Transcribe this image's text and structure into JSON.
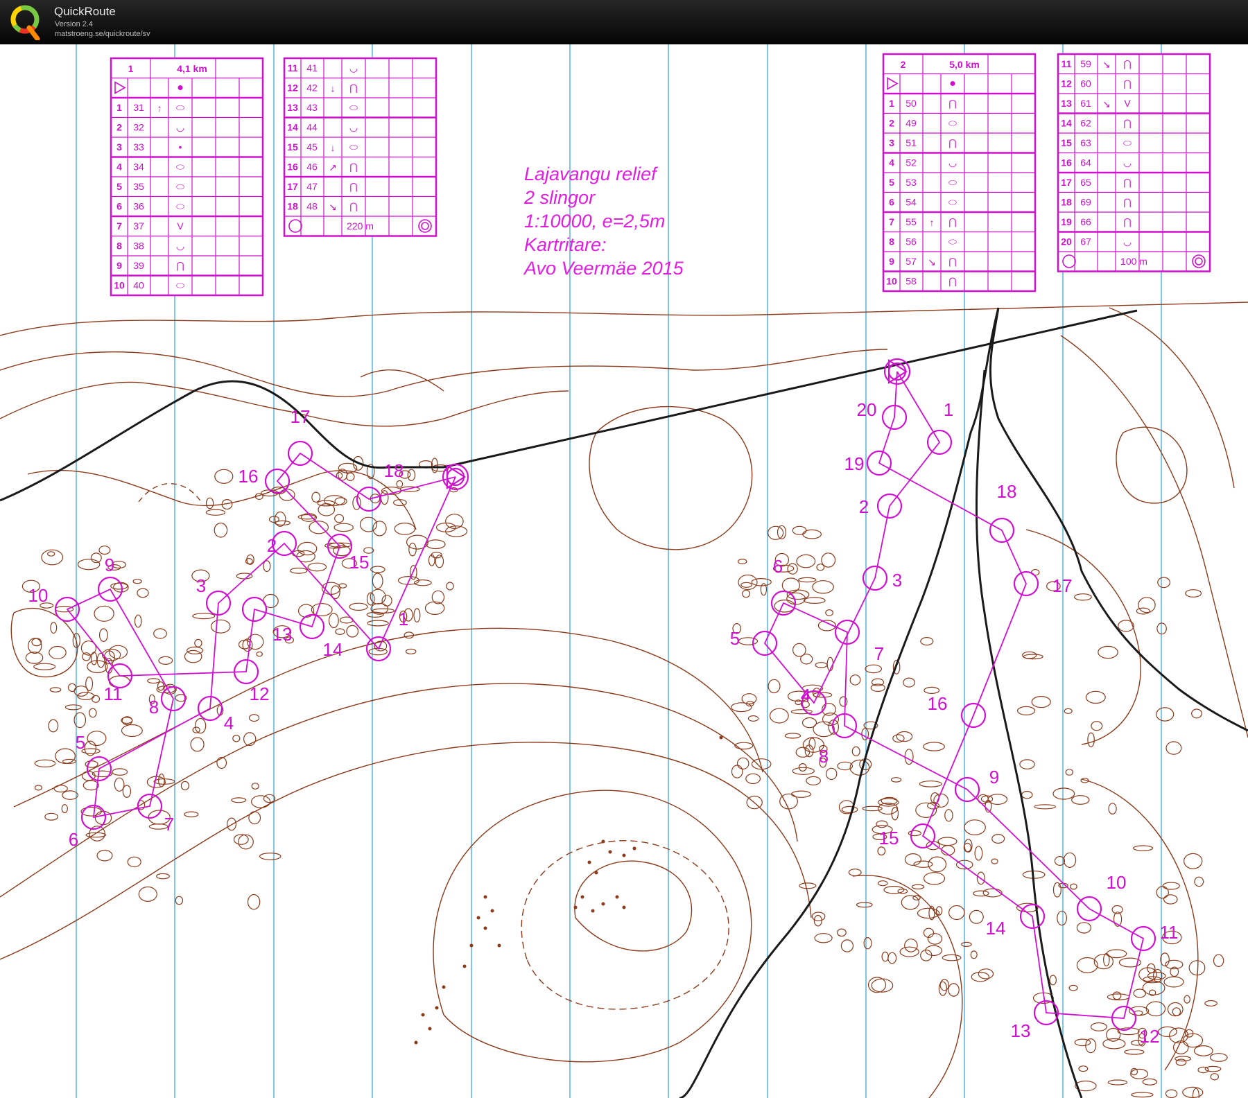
{
  "app": {
    "title": "QuickRoute",
    "version": "Version 2.4",
    "url": "matstroeng.se/quickroute/sv"
  },
  "map": {
    "title_lines": [
      "Lajavangu relief",
      "2 slingor",
      "1:10000, e=2,5m",
      "Kartritare:",
      "Avo Veermäe 2015"
    ],
    "accent_color": "#d10fd1",
    "contour_color": "#8b3a1a",
    "grid_color": "#3ea6d6",
    "course1": {
      "number": "1",
      "length": "4,1 km",
      "finish_distance": "220 m",
      "controls": [
        {
          "n": "1",
          "code": "31",
          "dir": "↑",
          "sym": "⬭"
        },
        {
          "n": "2",
          "code": "32",
          "dir": "",
          "sym": "◡"
        },
        {
          "n": "3",
          "code": "33",
          "dir": "",
          "sym": "•"
        },
        {
          "n": "4",
          "code": "34",
          "dir": "",
          "sym": "⬭"
        },
        {
          "n": "5",
          "code": "35",
          "dir": "",
          "sym": "⬭"
        },
        {
          "n": "6",
          "code": "36",
          "dir": "",
          "sym": "⬭"
        },
        {
          "n": "7",
          "code": "37",
          "dir": "",
          "sym": "V"
        },
        {
          "n": "8",
          "code": "38",
          "dir": "",
          "sym": "◡"
        },
        {
          "n": "9",
          "code": "39",
          "dir": "",
          "sym": "⋂"
        },
        {
          "n": "10",
          "code": "40",
          "dir": "",
          "sym": "⬭"
        },
        {
          "n": "11",
          "code": "41",
          "dir": "",
          "sym": "◡"
        },
        {
          "n": "12",
          "code": "42",
          "dir": "↓",
          "sym": "⋂"
        },
        {
          "n": "13",
          "code": "43",
          "dir": "",
          "sym": "⬭"
        },
        {
          "n": "14",
          "code": "44",
          "dir": "",
          "sym": "◡"
        },
        {
          "n": "15",
          "code": "45",
          "dir": "↓",
          "sym": "⬭"
        },
        {
          "n": "16",
          "code": "46",
          "dir": "↗",
          "sym": "⋂"
        },
        {
          "n": "17",
          "code": "47",
          "dir": "",
          "sym": "⋂"
        },
        {
          "n": "18",
          "code": "48",
          "dir": "↘",
          "sym": "⋂"
        }
      ]
    },
    "course2": {
      "number": "2",
      "length": "5,0 km",
      "finish_distance": "100 m",
      "controls": [
        {
          "n": "1",
          "code": "50",
          "dir": "",
          "sym": "⋂"
        },
        {
          "n": "2",
          "code": "49",
          "dir": "",
          "sym": "⬭"
        },
        {
          "n": "3",
          "code": "51",
          "dir": "",
          "sym": "⋂"
        },
        {
          "n": "4",
          "code": "52",
          "dir": "",
          "sym": "◡"
        },
        {
          "n": "5",
          "code": "53",
          "dir": "",
          "sym": "⬭"
        },
        {
          "n": "6",
          "code": "54",
          "dir": "",
          "sym": "⬭"
        },
        {
          "n": "7",
          "code": "55",
          "dir": "↑",
          "sym": "⋂"
        },
        {
          "n": "8",
          "code": "56",
          "dir": "",
          "sym": "⬭"
        },
        {
          "n": "9",
          "code": "57",
          "dir": "↘",
          "sym": "⋂"
        },
        {
          "n": "10",
          "code": "58",
          "dir": "",
          "sym": "⋂"
        },
        {
          "n": "11",
          "code": "59",
          "dir": "↘",
          "sym": "⋂"
        },
        {
          "n": "12",
          "code": "60",
          "dir": "",
          "sym": "⋂"
        },
        {
          "n": "13",
          "code": "61",
          "dir": "↘",
          "sym": "V"
        },
        {
          "n": "14",
          "code": "62",
          "dir": "",
          "sym": "⋂"
        },
        {
          "n": "15",
          "code": "63",
          "dir": "",
          "sym": "⬭"
        },
        {
          "n": "16",
          "code": "64",
          "dir": "",
          "sym": "◡"
        },
        {
          "n": "17",
          "code": "65",
          "dir": "",
          "sym": "⋂"
        },
        {
          "n": "18",
          "code": "69",
          "dir": "",
          "sym": "⋂"
        },
        {
          "n": "19",
          "code": "66",
          "dir": "",
          "sym": "⋂"
        },
        {
          "n": "20",
          "code": "67",
          "dir": "",
          "sym": "◡"
        }
      ]
    },
    "course1_labels": [
      "1",
      "2",
      "3",
      "4",
      "5",
      "6",
      "7",
      "8",
      "9",
      "10",
      "11",
      "12",
      "13",
      "14",
      "15",
      "16",
      "17",
      "18"
    ],
    "course2_labels": [
      "1",
      "2",
      "3",
      "4",
      "5",
      "6",
      "7",
      "8",
      "9",
      "10",
      "11",
      "12",
      "13",
      "14",
      "15",
      "16",
      "17",
      "18",
      "19",
      "20"
    ]
  }
}
